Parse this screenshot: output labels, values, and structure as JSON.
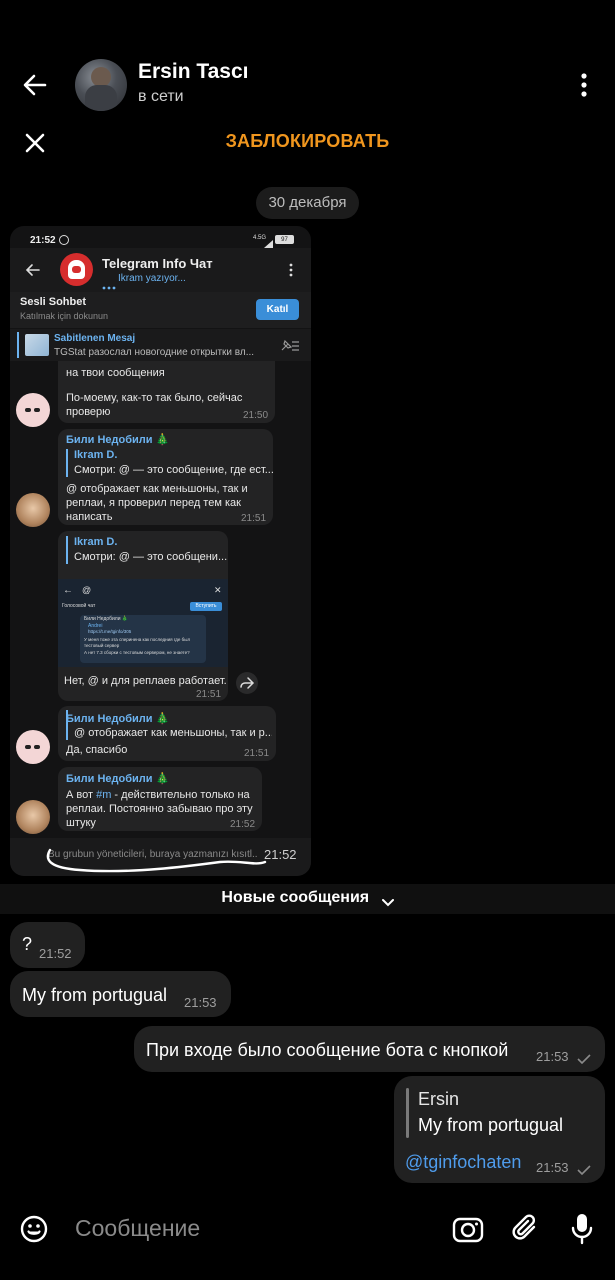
{
  "header": {
    "contact_name": "Ersin Tascı",
    "status": "в сети",
    "block_label": "ЗАБЛОКИРОВАТЬ"
  },
  "chat": {
    "date_chip": "30 декабря",
    "new_messages_label": "Новые сообщения",
    "messages": [
      {
        "text": "?",
        "time": "21:52"
      },
      {
        "text": "My from portugual",
        "time": "21:53"
      },
      {
        "text": "При входе было сообщение бота с кнопкой",
        "time": "21:53"
      },
      {
        "reply_name": "Ersin",
        "reply_text": "My from portugual",
        "text": "@tginfochaten",
        "time": "21:53"
      }
    ],
    "forwarded_time": "21:52"
  },
  "screenshot": {
    "status_time": "21:52",
    "status_net": "4.5G",
    "status_battery": "97",
    "chat_title": "Telegram Info Чат",
    "typing": "Ikram yazıyor...",
    "voice_chat_title": "Sesli Sohbet",
    "voice_chat_sub": "Katılmak için dokunun",
    "join_label": "Katıl",
    "pinned_title": "Sabitlenen Mesaj",
    "pinned_text": "TGStat разослал новогодние открытки вл...",
    "msg1_top": "на твои сообщения",
    "msg1_text": "По-моему, как-то так было, сейчас проверю",
    "msg1_time": "21:50",
    "msg2_name": "Били Недобили 🎄",
    "msg2_reply_name": "Ikram D.",
    "msg2_reply_text": "Смотри: @ — это сообщение, где ест...",
    "msg2_text": "@ отображает как меньшоны, так и реплаи, я проверил перед тем как написать",
    "msg2_time": "21:51",
    "msg3_reply_name": "Ikram D.",
    "msg3_reply_text": "Смотри: @ — это сообщени...",
    "msg3_text": "Нет, @ и для реплаев работает.",
    "msg3_time": "21:51",
    "inner_search": "@",
    "inner_voice": "Голосовой чат",
    "inner_join": "Вступить",
    "inner_name": "Били Недобили 🎄",
    "inner_quote_name": "Andrei",
    "inner_link": "https://t.me/tginfo/305",
    "inner_text": "У меня тоже эта сперинена как последния где был тестовый сервер",
    "inner_text2": "А нет 7.3 сборки с тестовым сервером, не знаете?",
    "msg4_name": "Били Недобили 🎄",
    "msg4_reply_text": "@ отображает как меньшоны, так и р...",
    "msg4_text": "Да, спасибо",
    "msg4_time": "21:51",
    "msg5_name": "Били Недобили 🎄",
    "msg5_text_a": "А вот ",
    "msg5_tag": "#m",
    "msg5_text_b": " - действительно только на реплаи. Постоянно забываю про эту штуку",
    "msg5_time": "21:52",
    "input_text": "Bu grubun yöneticileri, buraya yazmanızı kısıtl..."
  },
  "composer": {
    "placeholder": "Сообщение"
  },
  "colors": {
    "accent_orange": "#f0961e",
    "link_blue": "#4f9cec",
    "bubble_dark": "#212121",
    "ss_join_blue": "#3a8ed8"
  }
}
